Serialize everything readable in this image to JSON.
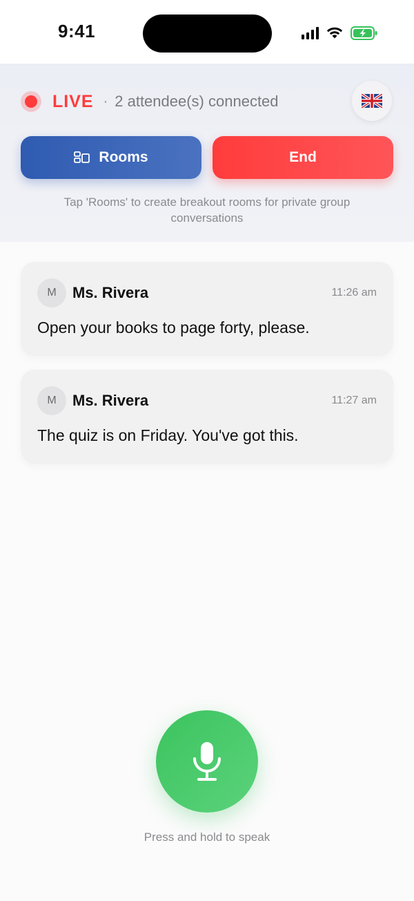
{
  "status_bar": {
    "time": "9:41",
    "icons": [
      "signal-icon",
      "wifi-icon",
      "battery-charging-icon"
    ]
  },
  "header": {
    "live_label": "LIVE",
    "separator": "·",
    "attendees": "2 attendee(s) connected",
    "language_flag": "🇬🇧",
    "rooms_label": "Rooms",
    "end_label": "End",
    "hint": "Tap 'Rooms' to create breakout rooms for private group conversations"
  },
  "messages": [
    {
      "avatar": "M",
      "sender": "Ms. Rivera",
      "time": "11:26 am",
      "text": "Open your books to page forty, please."
    },
    {
      "avatar": "M",
      "sender": "Ms. Rivera",
      "time": "11:27 am",
      "text": "The quiz is on Friday. You've got this."
    }
  ],
  "mic": {
    "hint": "Press and hold to speak"
  },
  "colors": {
    "live_red": "#ff3b3b",
    "rooms_blue": "#2f5bb1",
    "end_red": "#ff3c3c",
    "mic_green": "#3cc45f"
  }
}
